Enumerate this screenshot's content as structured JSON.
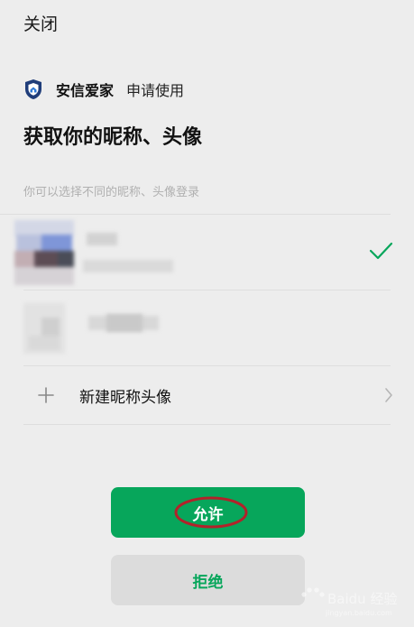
{
  "header": {
    "close_label": "关闭"
  },
  "app": {
    "name": "安信爱家",
    "action": "申请使用",
    "logo_icon": "shield-icon"
  },
  "permission": {
    "title": "获取你的昵称、头像",
    "subtitle": "你可以选择不同的昵称、头像登录"
  },
  "profiles": [
    {
      "selected": true
    },
    {
      "selected": false
    }
  ],
  "new_profile": {
    "label": "新建昵称头像"
  },
  "buttons": {
    "allow_label": "允许",
    "deny_label": "拒绝"
  },
  "watermark": {
    "text": "Baidu 经验",
    "subtext": "jingyan.baidu.com"
  },
  "colors": {
    "accent": "#07a65b",
    "background": "#ededed",
    "annotation": "#b2222a"
  }
}
